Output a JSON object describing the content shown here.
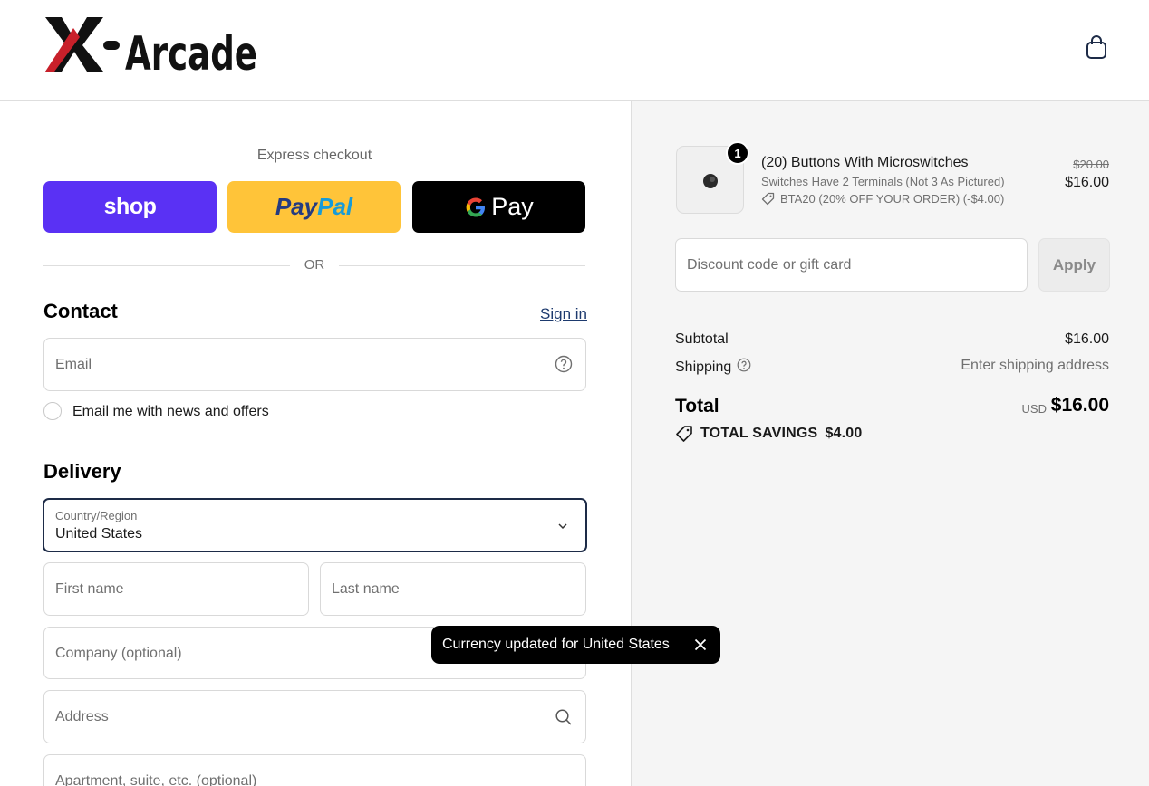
{
  "header": {
    "logo_text": "X-Arcade",
    "cart_icon": "shopping-bag-icon"
  },
  "express": {
    "title": "Express checkout",
    "shop_label": "shop",
    "paypal_label_1": "Pay",
    "paypal_label_2": "Pal",
    "gpay_label": "Pay",
    "or_label": "OR"
  },
  "contact": {
    "title": "Contact",
    "signin_label": "Sign in",
    "email_placeholder": "Email",
    "newsletter_label": "Email me with news and offers",
    "newsletter_checked": false
  },
  "delivery": {
    "title": "Delivery",
    "country_label": "Country/Region",
    "country_value": "United States",
    "first_name_placeholder": "First name",
    "last_name_placeholder": "Last name",
    "company_placeholder": "Company (optional)",
    "address_placeholder": "Address",
    "apartment_placeholder": "Apartment, suite, etc. (optional)"
  },
  "toast": {
    "message": "Currency updated for United States"
  },
  "order": {
    "quantity": "1",
    "product_title": "(20) Buttons With Microswitches",
    "product_variant": "Switches Have 2 Terminals (Not 3 As Pictured)",
    "product_discount": "BTA20 (20% OFF YOUR ORDER) (-$4.00)",
    "old_price": "$20.00",
    "price": "$16.00",
    "discount_placeholder": "Discount code or gift card",
    "apply_label": "Apply",
    "subtotal_label": "Subtotal",
    "subtotal_value": "$16.00",
    "shipping_label": "Shipping",
    "shipping_value": "Enter shipping address",
    "total_label": "Total",
    "total_currency": "USD",
    "total_value": "$16.00",
    "savings_label": "TOTAL SAVINGS",
    "savings_value": "$4.00"
  },
  "colors": {
    "shop": "#5a31f4",
    "paypal": "#ffc439",
    "gpay": "#000000",
    "focus_border": "#1d2b47",
    "link": "#1d3a6e"
  }
}
